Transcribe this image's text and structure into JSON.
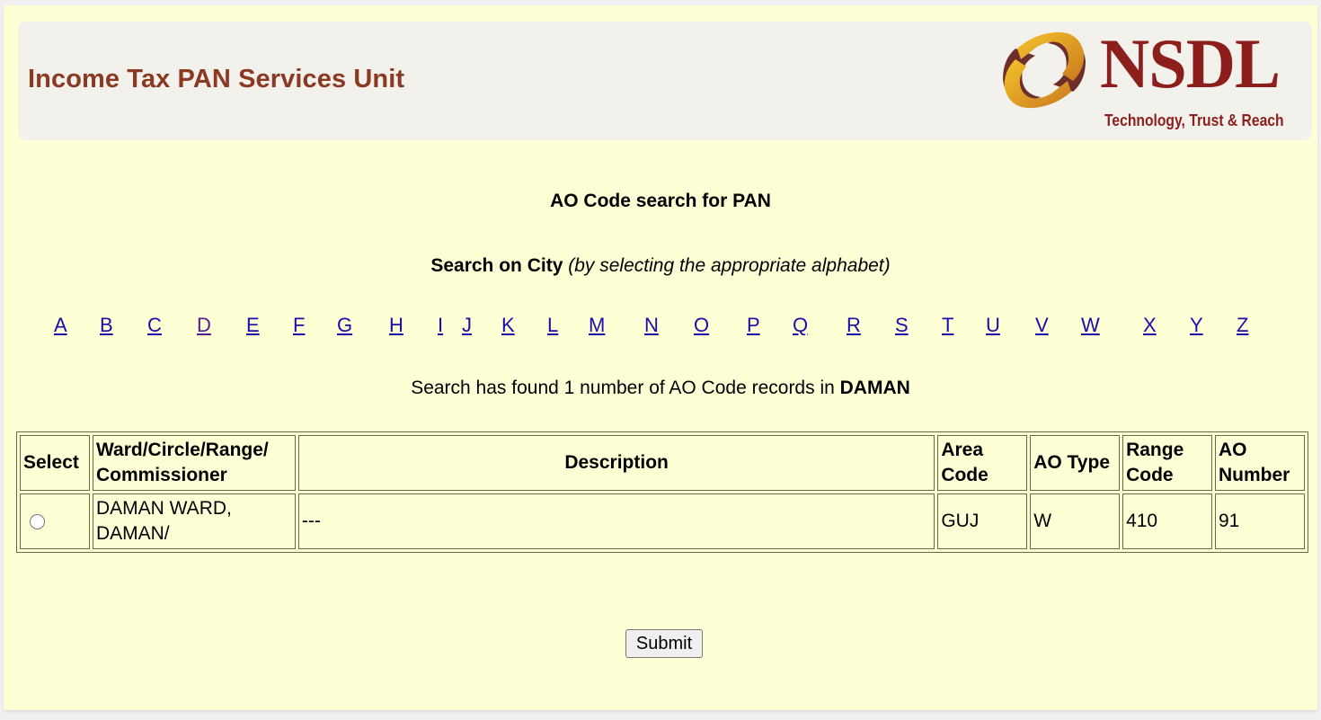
{
  "header": {
    "title": "Income Tax PAN Services Unit",
    "logo": {
      "name": "NSDL",
      "tagline": "Technology, Trust & Reach",
      "icon": "nsdl-swirl-logo",
      "colors": {
        "brand_red": "#8c1f1c",
        "gold": "#e8a423",
        "maroon": "#6e2f2a"
      }
    }
  },
  "page": {
    "title": "AO Code search for PAN",
    "subtitle_bold": "Search on City",
    "subtitle_italic": "(by selecting the appropriate alphabet)",
    "alphabet": [
      "A",
      "B",
      "C",
      "D",
      "E",
      "F",
      "G",
      "H",
      "I",
      "J",
      "K",
      "L",
      "M",
      "N",
      "O",
      "P",
      "Q",
      "R",
      "S",
      "T",
      "U",
      "V",
      "W",
      "X",
      "Y",
      "Z"
    ],
    "visited_letter": "D",
    "result_prefix": "Search has found 1 number of AO Code records in",
    "result_city": "DAMAN"
  },
  "table": {
    "headers": {
      "select": "Select",
      "ward": "Ward/Circle/Range/ Commissioner",
      "description": "Description",
      "area_code": "Area Code",
      "ao_type": "AO Type",
      "range_code": "Range Code",
      "ao_number": "AO Number"
    },
    "rows": [
      {
        "selected": false,
        "ward": "DAMAN WARD, DAMAN/",
        "description": "---",
        "area_code": "GUJ",
        "ao_type": "W",
        "range_code": "410",
        "ao_number": "91"
      }
    ]
  },
  "actions": {
    "submit_label": "Submit"
  },
  "colors": {
    "page_bg": "#ffffd6",
    "header_bg": "#f3f1ec",
    "header_title": "#8a3a22",
    "link": "#1a0dab",
    "link_visited": "#551a8b"
  }
}
